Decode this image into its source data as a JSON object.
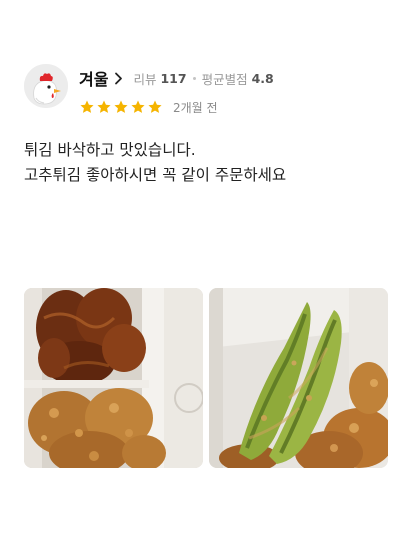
{
  "review": {
    "user": {
      "nickname": "겨울",
      "avatar": "chicken-avatar-icon"
    },
    "stats": {
      "review_label": "리뷰",
      "review_count": "117",
      "avg_label": "평균별점",
      "avg_rating": "4.8"
    },
    "rating": {
      "stars": 5,
      "max": 5,
      "star_color": "#f5b400"
    },
    "date": "2개월 전",
    "text_lines": [
      "튀김 바삭하고 맛있습니다.",
      "고추튀김 좋아하시면 꼭 같이 주문하세요"
    ],
    "photos": [
      {
        "name": "fried-chicken-glazed-photo",
        "subject": "glazed and crispy fried chicken in box"
      },
      {
        "name": "fried-pepper-photo",
        "subject": "fried stuffed green peppers on fried chicken"
      }
    ]
  }
}
